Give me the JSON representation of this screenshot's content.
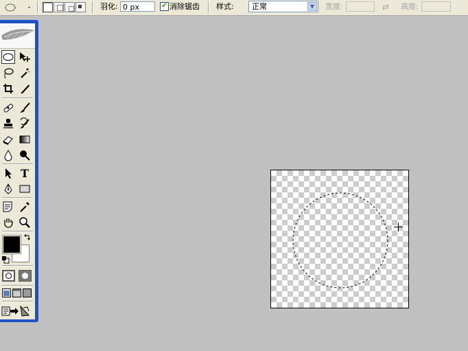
{
  "options_bar": {
    "tool_preset_icon": "ellipse-marquee-icon",
    "selection_modes": [
      "new-selection",
      "add-to-selection",
      "subtract-from-selection",
      "intersect-selection"
    ],
    "feather_label": "羽化:",
    "feather_value": "0 px",
    "antialias_label": "消除锯齿",
    "antialias_checked": true,
    "style_label": "样式:",
    "style_value": "正常",
    "width_label": "宽度:",
    "width_value": "",
    "swap_icon": "swap-arrows-icon",
    "height_label": "高度:",
    "height_value": ""
  },
  "toolbox": {
    "header_icon": "feather-logo-icon",
    "active_tool": "elliptical-marquee",
    "foreground_color": "#000000",
    "background_color": "#ffffff"
  },
  "canvas": {
    "background": "transparent-checkerboard",
    "selection_shape": "ellipse"
  }
}
